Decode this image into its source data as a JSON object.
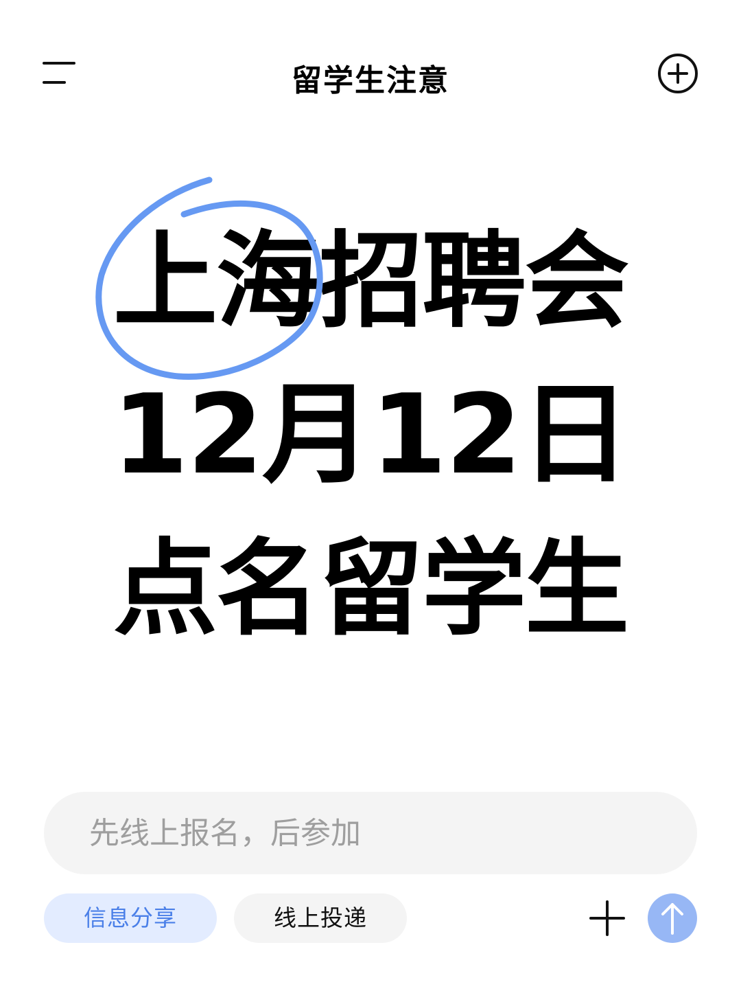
{
  "header": {
    "title": "留学生注意",
    "menu_icon": "menu-icon",
    "new_icon": "plus-circle-icon"
  },
  "content": {
    "line1": "上海招聘会",
    "line2": "12月12日",
    "line3": "点名留学生",
    "highlight_color": "#6699f2"
  },
  "composer": {
    "placeholder": "先线上报名，后参加",
    "chips": [
      {
        "label": "信息分享"
      },
      {
        "label": "线上投递"
      }
    ],
    "add_icon": "plus-icon",
    "send_icon": "arrow-up-icon",
    "send_color": "#97b7f5"
  }
}
